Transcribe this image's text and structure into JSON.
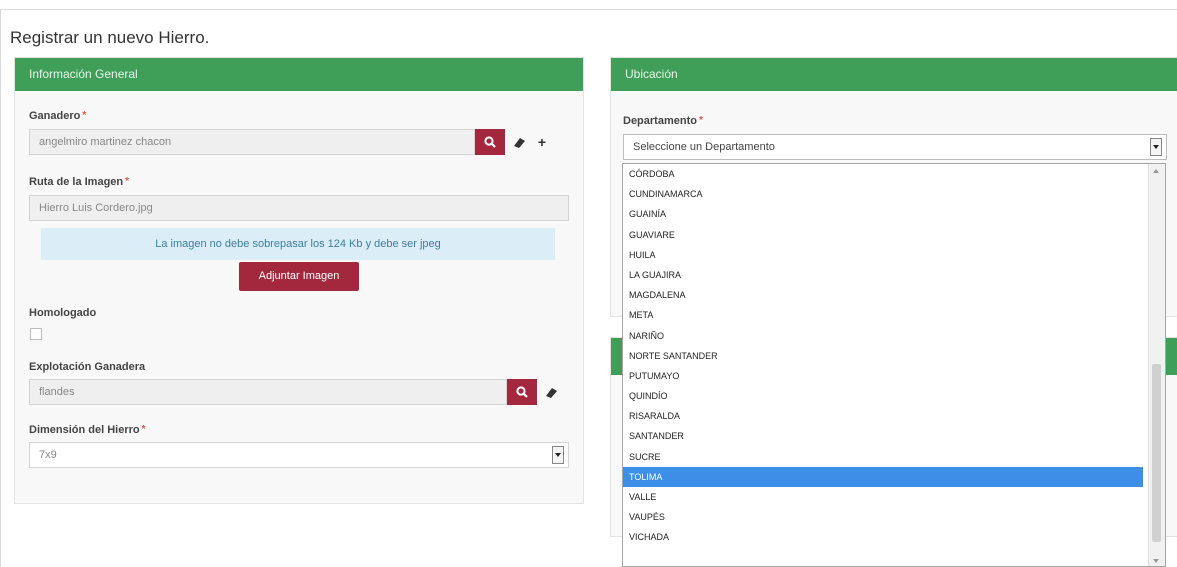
{
  "page_title": "Registrar un nuevo Hierro.",
  "general": {
    "header": "Información General",
    "ganadero": {
      "label": "Ganadero",
      "value": "angelmiro martinez chacon"
    },
    "ruta": {
      "label": "Ruta de la Imagen",
      "value": "Hierro Luis Cordero.jpg"
    },
    "info_text": "La imagen no debe sobrepasar los 124 Kb y debe ser jpeg",
    "attach_button": "Adjuntar Imagen",
    "homologado_label": "Homologado",
    "explotacion": {
      "label": "Explotación Ganadera",
      "value": "flandes"
    },
    "dimension": {
      "label": "Dimensión del Hierro",
      "value": "7x9"
    }
  },
  "ubicacion": {
    "header": "Ubicación",
    "departamento": {
      "label": "Departamento",
      "value": "Seleccione un Departamento"
    },
    "options": [
      "Córdoba",
      "Cundinamarca",
      "Guainía",
      "Guaviare",
      "Huila",
      "La Guajira",
      "Magdalena",
      "Meta",
      "Nariño",
      "Norte Santander",
      "Putumayo",
      "Quindío",
      "Risaralda",
      "Santander",
      "Sucre",
      "Tolima",
      "Valle",
      "Vaupés",
      "Vichada"
    ],
    "selected_option": "Tolima"
  },
  "required_mark": "*",
  "icons": {
    "search": "search-icon",
    "eraser": "eraser-icon",
    "add": "plus-icon"
  },
  "colors": {
    "header_green": "#3f9e58",
    "button_maroon": "#a4283d",
    "info_blue": "#dbeef7",
    "selected_blue": "#3c8ee6"
  }
}
